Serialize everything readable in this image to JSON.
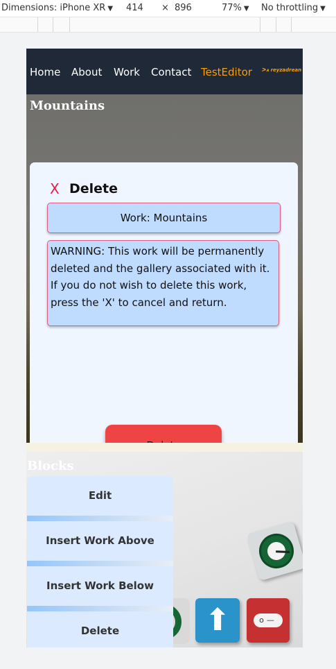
{
  "devtools": {
    "dimensions": "Dimensions: iPhone XR",
    "width": "414",
    "times": "×",
    "height": "896",
    "zoom": "77%",
    "throttling": "No throttling",
    "dropdown_glyph": "▼"
  },
  "navbar": {
    "links": [
      "Home",
      "About",
      "Work",
      "Contact",
      "TestEditor"
    ],
    "logo_text": "ᐳ⩚ reyzadrean",
    "accent_color": "#f59e0b",
    "background_color": "#1f2937"
  },
  "mountains": {
    "title": "Mountains"
  },
  "delete_modal": {
    "close_label": "X",
    "title": "Delete",
    "work_field_value": "Work: Mountains",
    "warning_text": "WARNING: This work will be permanently deleted and the gallery associated with it. If you do not wish to delete this work, press the 'X' to cancel and return.",
    "delete_button_label": "Delete",
    "delete_button_color": "#ef4444"
  },
  "blocks": {
    "title": "Blocks",
    "menu_items": [
      "Edit",
      "Insert Work Above",
      "Insert Work Below",
      "Delete"
    ]
  }
}
